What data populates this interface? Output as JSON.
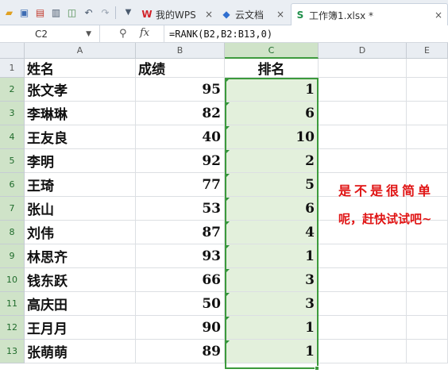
{
  "quick_access": {
    "icons": [
      "folder-open-icon",
      "save-icon",
      "export-pdf-icon",
      "print-icon",
      "print-preview-icon",
      "undo-icon",
      "redo-icon",
      "more-dropdown-icon"
    ]
  },
  "tabs": [
    {
      "icon": "wps-logo-icon",
      "icon_glyph": "W",
      "label": "我的WPS",
      "close": "×"
    },
    {
      "icon": "cloud-docs-icon",
      "icon_glyph": "◆",
      "label": "云文档",
      "close": "×"
    },
    {
      "icon": "spreadsheet-icon",
      "icon_glyph": "S",
      "label": "工作簿1.xlsx *",
      "close": "×",
      "active": true
    }
  ],
  "formula_bar": {
    "cell_ref": "C2",
    "fx": "fx",
    "formula": "=RANK(B2,B2:B13,0)"
  },
  "columns": [
    "A",
    "B",
    "C",
    "D",
    "E"
  ],
  "rows": [
    "1",
    "2",
    "3",
    "4",
    "5",
    "6",
    "7",
    "8",
    "9",
    "10",
    "11",
    "12",
    "13"
  ],
  "header": {
    "name": "姓名",
    "score": "成绩",
    "rank": "排名"
  },
  "records": [
    {
      "name": "张文孝",
      "score": "95",
      "rank": "1"
    },
    {
      "name": "李琳琳",
      "score": "82",
      "rank": "6"
    },
    {
      "name": "王友良",
      "score": "40",
      "rank": "10"
    },
    {
      "name": "李明",
      "score": "92",
      "rank": "2"
    },
    {
      "name": "王琦",
      "score": "77",
      "rank": "5"
    },
    {
      "name": "张山",
      "score": "53",
      "rank": "6"
    },
    {
      "name": "刘伟",
      "score": "87",
      "rank": "4"
    },
    {
      "name": "林思齐",
      "score": "93",
      "rank": "1"
    },
    {
      "name": "钱东跃",
      "score": "66",
      "rank": "3"
    },
    {
      "name": "高庆田",
      "score": "50",
      "rank": "3"
    },
    {
      "name": "王月月",
      "score": "90",
      "rank": "1"
    },
    {
      "name": "张萌萌",
      "score": "89",
      "rank": "1"
    }
  ],
  "annotations": {
    "line1": "是不是很简单",
    "line2": "呢，赶快试试吧~"
  },
  "colors": {
    "selection": "#3c9a3c",
    "rank_fill": "#e3f0dc",
    "annotation": "#e01414"
  }
}
